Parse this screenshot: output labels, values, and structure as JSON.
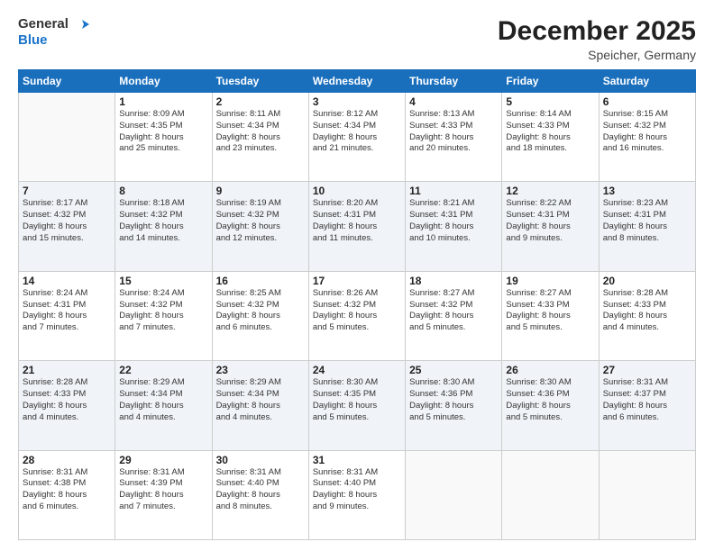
{
  "logo": {
    "line1": "General",
    "line2": "Blue"
  },
  "title": "December 2025",
  "subtitle": "Speicher, Germany",
  "days_header": [
    "Sunday",
    "Monday",
    "Tuesday",
    "Wednesday",
    "Thursday",
    "Friday",
    "Saturday"
  ],
  "weeks": [
    [
      {
        "num": "",
        "info": ""
      },
      {
        "num": "1",
        "info": "Sunrise: 8:09 AM\nSunset: 4:35 PM\nDaylight: 8 hours\nand 25 minutes."
      },
      {
        "num": "2",
        "info": "Sunrise: 8:11 AM\nSunset: 4:34 PM\nDaylight: 8 hours\nand 23 minutes."
      },
      {
        "num": "3",
        "info": "Sunrise: 8:12 AM\nSunset: 4:34 PM\nDaylight: 8 hours\nand 21 minutes."
      },
      {
        "num": "4",
        "info": "Sunrise: 8:13 AM\nSunset: 4:33 PM\nDaylight: 8 hours\nand 20 minutes."
      },
      {
        "num": "5",
        "info": "Sunrise: 8:14 AM\nSunset: 4:33 PM\nDaylight: 8 hours\nand 18 minutes."
      },
      {
        "num": "6",
        "info": "Sunrise: 8:15 AM\nSunset: 4:32 PM\nDaylight: 8 hours\nand 16 minutes."
      }
    ],
    [
      {
        "num": "7",
        "info": "Sunrise: 8:17 AM\nSunset: 4:32 PM\nDaylight: 8 hours\nand 15 minutes."
      },
      {
        "num": "8",
        "info": "Sunrise: 8:18 AM\nSunset: 4:32 PM\nDaylight: 8 hours\nand 14 minutes."
      },
      {
        "num": "9",
        "info": "Sunrise: 8:19 AM\nSunset: 4:32 PM\nDaylight: 8 hours\nand 12 minutes."
      },
      {
        "num": "10",
        "info": "Sunrise: 8:20 AM\nSunset: 4:31 PM\nDaylight: 8 hours\nand 11 minutes."
      },
      {
        "num": "11",
        "info": "Sunrise: 8:21 AM\nSunset: 4:31 PM\nDaylight: 8 hours\nand 10 minutes."
      },
      {
        "num": "12",
        "info": "Sunrise: 8:22 AM\nSunset: 4:31 PM\nDaylight: 8 hours\nand 9 minutes."
      },
      {
        "num": "13",
        "info": "Sunrise: 8:23 AM\nSunset: 4:31 PM\nDaylight: 8 hours\nand 8 minutes."
      }
    ],
    [
      {
        "num": "14",
        "info": "Sunrise: 8:24 AM\nSunset: 4:31 PM\nDaylight: 8 hours\nand 7 minutes."
      },
      {
        "num": "15",
        "info": "Sunrise: 8:24 AM\nSunset: 4:32 PM\nDaylight: 8 hours\nand 7 minutes."
      },
      {
        "num": "16",
        "info": "Sunrise: 8:25 AM\nSunset: 4:32 PM\nDaylight: 8 hours\nand 6 minutes."
      },
      {
        "num": "17",
        "info": "Sunrise: 8:26 AM\nSunset: 4:32 PM\nDaylight: 8 hours\nand 5 minutes."
      },
      {
        "num": "18",
        "info": "Sunrise: 8:27 AM\nSunset: 4:32 PM\nDaylight: 8 hours\nand 5 minutes."
      },
      {
        "num": "19",
        "info": "Sunrise: 8:27 AM\nSunset: 4:33 PM\nDaylight: 8 hours\nand 5 minutes."
      },
      {
        "num": "20",
        "info": "Sunrise: 8:28 AM\nSunset: 4:33 PM\nDaylight: 8 hours\nand 4 minutes."
      }
    ],
    [
      {
        "num": "21",
        "info": "Sunrise: 8:28 AM\nSunset: 4:33 PM\nDaylight: 8 hours\nand 4 minutes."
      },
      {
        "num": "22",
        "info": "Sunrise: 8:29 AM\nSunset: 4:34 PM\nDaylight: 8 hours\nand 4 minutes."
      },
      {
        "num": "23",
        "info": "Sunrise: 8:29 AM\nSunset: 4:34 PM\nDaylight: 8 hours\nand 4 minutes."
      },
      {
        "num": "24",
        "info": "Sunrise: 8:30 AM\nSunset: 4:35 PM\nDaylight: 8 hours\nand 5 minutes."
      },
      {
        "num": "25",
        "info": "Sunrise: 8:30 AM\nSunset: 4:36 PM\nDaylight: 8 hours\nand 5 minutes."
      },
      {
        "num": "26",
        "info": "Sunrise: 8:30 AM\nSunset: 4:36 PM\nDaylight: 8 hours\nand 5 minutes."
      },
      {
        "num": "27",
        "info": "Sunrise: 8:31 AM\nSunset: 4:37 PM\nDaylight: 8 hours\nand 6 minutes."
      }
    ],
    [
      {
        "num": "28",
        "info": "Sunrise: 8:31 AM\nSunset: 4:38 PM\nDaylight: 8 hours\nand 6 minutes."
      },
      {
        "num": "29",
        "info": "Sunrise: 8:31 AM\nSunset: 4:39 PM\nDaylight: 8 hours\nand 7 minutes."
      },
      {
        "num": "30",
        "info": "Sunrise: 8:31 AM\nSunset: 4:40 PM\nDaylight: 8 hours\nand 8 minutes."
      },
      {
        "num": "31",
        "info": "Sunrise: 8:31 AM\nSunset: 4:40 PM\nDaylight: 8 hours\nand 9 minutes."
      },
      {
        "num": "",
        "info": ""
      },
      {
        "num": "",
        "info": ""
      },
      {
        "num": "",
        "info": ""
      }
    ]
  ]
}
